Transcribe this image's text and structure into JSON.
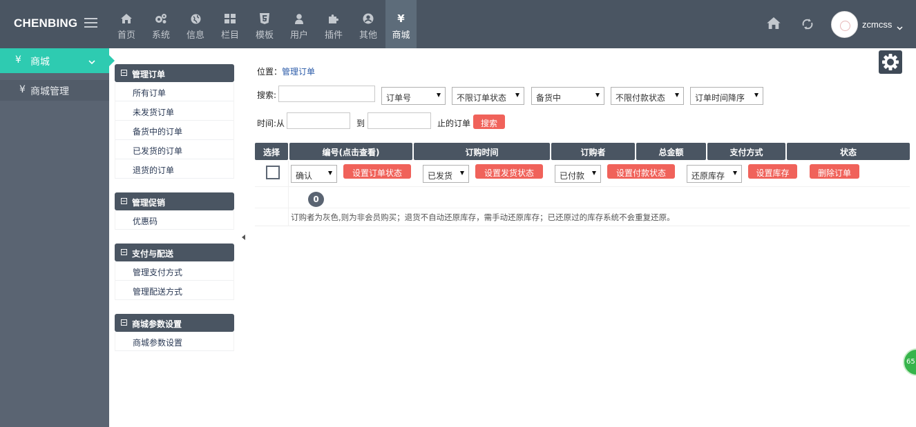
{
  "header": {
    "brand": "CHENBING",
    "nav": [
      {
        "label": "首页",
        "icon": "home-icon"
      },
      {
        "label": "系统",
        "icon": "gears-icon"
      },
      {
        "label": "信息",
        "icon": "globe-icon"
      },
      {
        "label": "栏目",
        "icon": "grid-icon"
      },
      {
        "label": "模板",
        "icon": "html5-icon"
      },
      {
        "label": "用户",
        "icon": "user-icon"
      },
      {
        "label": "插件",
        "icon": "puzzle-icon"
      },
      {
        "label": "其他",
        "icon": "user-circle-icon"
      },
      {
        "label": "商城",
        "icon": "yen-icon"
      }
    ],
    "username": "zcmcss"
  },
  "sidebar": {
    "active_label": "商城",
    "sub_label": "商城管理",
    "yen": "¥"
  },
  "menu": {
    "groups": [
      {
        "title": "管理订单",
        "items": [
          "所有订单",
          "未发货订单",
          "备货中的订单",
          "已发货的订单",
          "退货的订单"
        ]
      },
      {
        "title": "管理促销",
        "items": [
          "优惠码"
        ]
      },
      {
        "title": "支付与配送",
        "items": [
          "管理支付方式",
          "管理配送方式"
        ]
      },
      {
        "title": "商城参数设置",
        "items": [
          "商城参数设置"
        ]
      }
    ]
  },
  "breadcrumb": {
    "prefix": "位置：",
    "current": "管理订单"
  },
  "search": {
    "label": "搜索:",
    "keyword_value": "",
    "field_select": "订单号",
    "order_status_select": "不限订单状态",
    "ship_status_select": "备货中",
    "pay_status_select": "不限付款状态",
    "sort_select": "订单时间降序",
    "time_from_label": "时间:从",
    "to_label": "到",
    "until_label": "止的订单",
    "search_button": "搜索"
  },
  "table": {
    "headers": [
      "选择",
      "编号(点击查看)",
      "订购时间",
      "订购者",
      "总金额",
      "支付方式",
      "状态"
    ],
    "actions": {
      "order_state_select": "确认",
      "set_order_state": "设置订单状态",
      "ship_state_select": "已发货",
      "set_ship_state": "设置发货状态",
      "pay_state_select": "已付款",
      "set_pay_state": "设置付款状态",
      "stock_select": "还原库存",
      "set_stock": "设置库存",
      "delete_order": "删除订单"
    },
    "count": "0",
    "note": "订购者为灰色,则为非会员购买；退货不自动还原库存，需手动还原库存；已还原过的库存系统不会重复还原。"
  },
  "floating_badge": "65"
}
